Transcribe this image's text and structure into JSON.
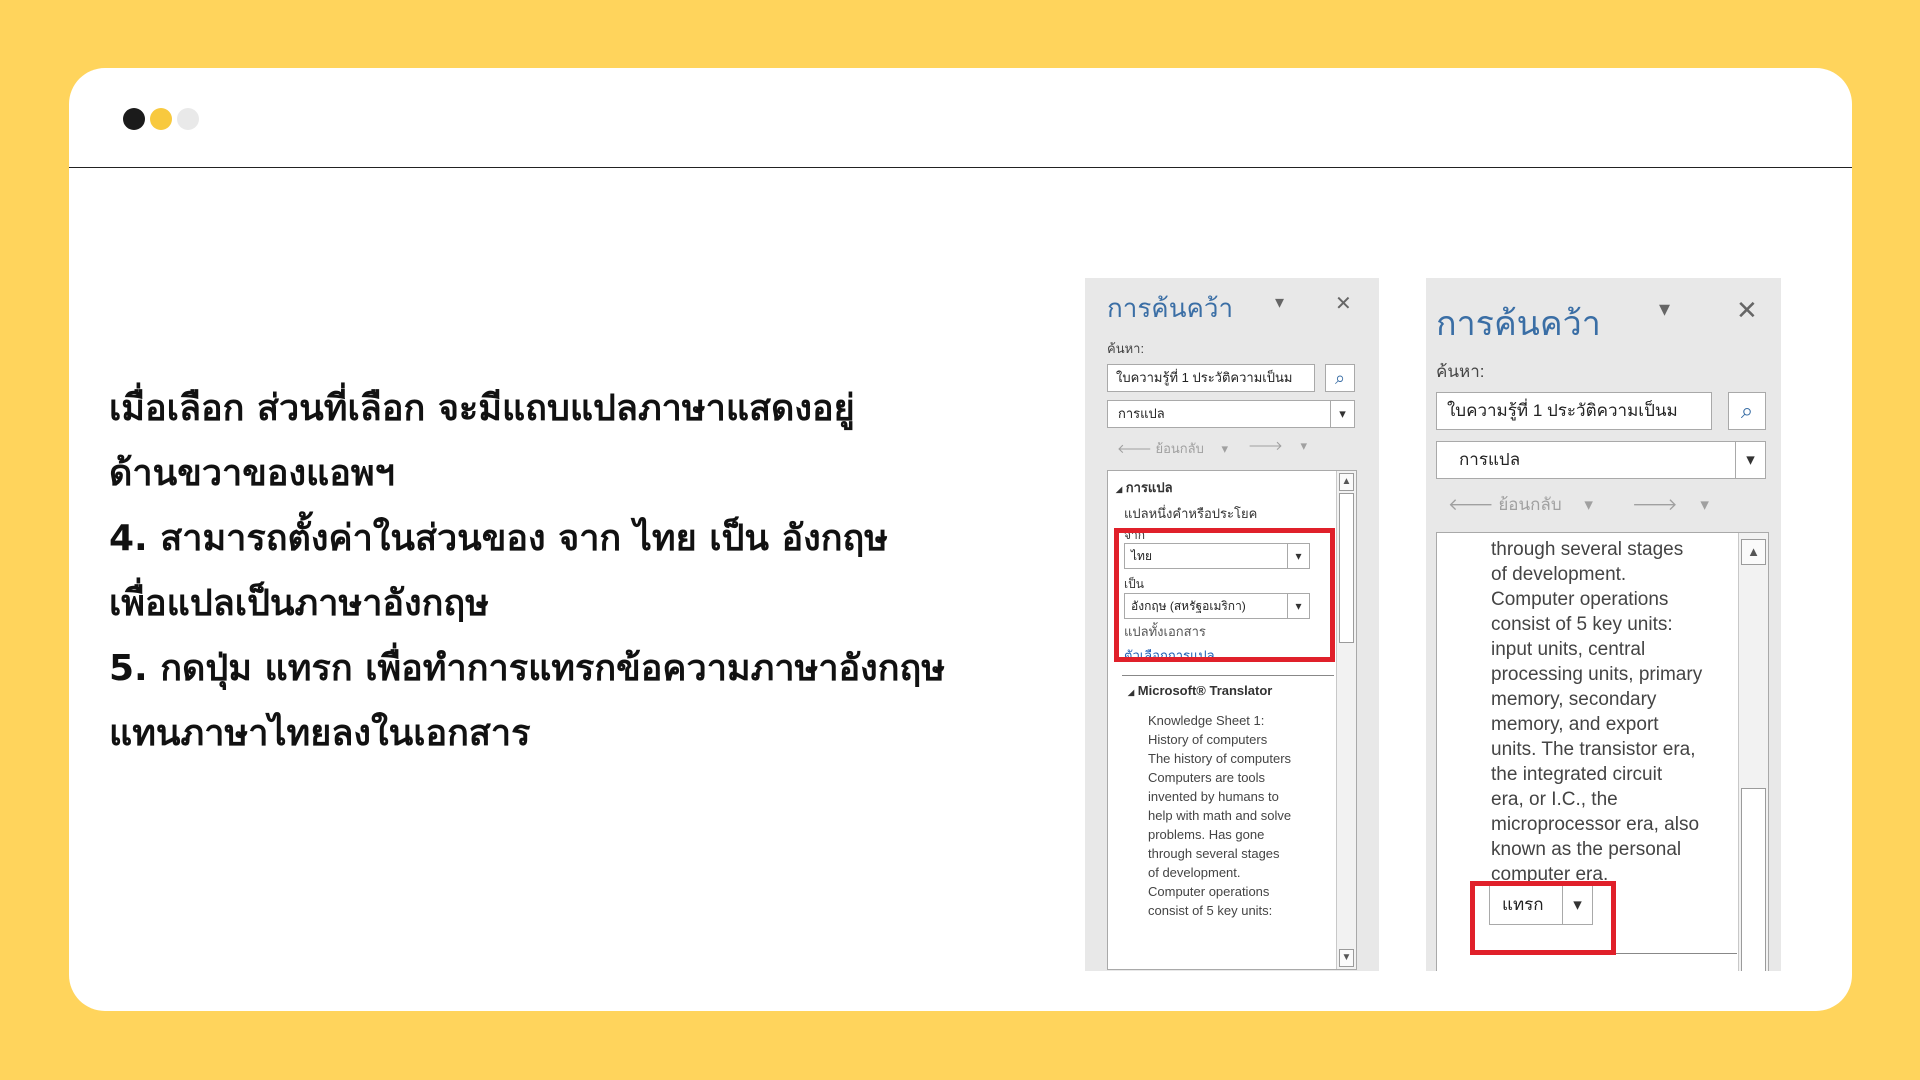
{
  "instructions": [
    "เมื่อเลือก ส่วนที่เลือก จะมีแถบแปลภาษาแสดงอยู่",
    "ด้านขวาของแอพฯ",
    "4. สามารถตั้งค่าในส่วนของ จาก ไทย เป็น อังกฤษ",
    "เพื่อแปลเป็นภาษาอังกฤษ",
    "5. กดปุ่ม แทรก เพื่อทำการแทรกข้อความภาษาอังกฤษ",
    "แทนภาษาไทยลงในเอกสาร"
  ],
  "pane_small": {
    "title": "การค้นคว้า",
    "search_label": "ค้นหา:",
    "search_value": "ใบความรู้ที่ 1 ประวัติความเป็นม",
    "service": "การแปล",
    "back": "ย้อนกลับ",
    "section_translation": "การแปล",
    "translate_word": "แปลหนึ่งคำหรือประโยค",
    "from_label": "จาก",
    "from_value": "ไทย",
    "to_label": "เป็น",
    "to_value": "อังกฤษ (สหรัฐอเมริกา)",
    "translate_doc": "แปลทั้งเอกสาร",
    "options_link": "ตัวเลือกการแปล...",
    "ms_translator": "Microsoft® Translator",
    "result_lines": [
      "Knowledge Sheet 1:",
      "History of computers",
      "The history of computers",
      "Computers are tools",
      "invented by humans to",
      "help with math and solve",
      "problems.  Has gone",
      "through several stages",
      "of development.",
      "Computer operations",
      "consist of 5 key units:"
    ]
  },
  "pane_large": {
    "title": "การค้นคว้า",
    "search_label": "ค้นหา:",
    "search_value": "ใบความรู้ที่ 1 ประวัติความเป็นม",
    "service": "การแปล",
    "back": "ย้อนกลับ",
    "result_lines": [
      "through several stages",
      "of development.",
      "Computer operations",
      "consist of 5 key units:",
      "input units, central",
      "processing units, primary",
      "memory, secondary",
      "memory, and export",
      "units. The transistor era,",
      "the integrated circuit",
      "era, or I.C., the",
      "microprocessor era, also",
      "known as the personal",
      "computer era."
    ],
    "insert_label": "แทรก"
  },
  "colors": {
    "background": "#FFD45C",
    "card": "#FFFFFF",
    "highlight": "#E0202A",
    "pane_title": "#3a6ea5"
  },
  "icons": {
    "dropdown": "▾",
    "close": "✕",
    "search": "⌕",
    "back": "🡐",
    "forward": "🡒",
    "collapse": "◢"
  }
}
